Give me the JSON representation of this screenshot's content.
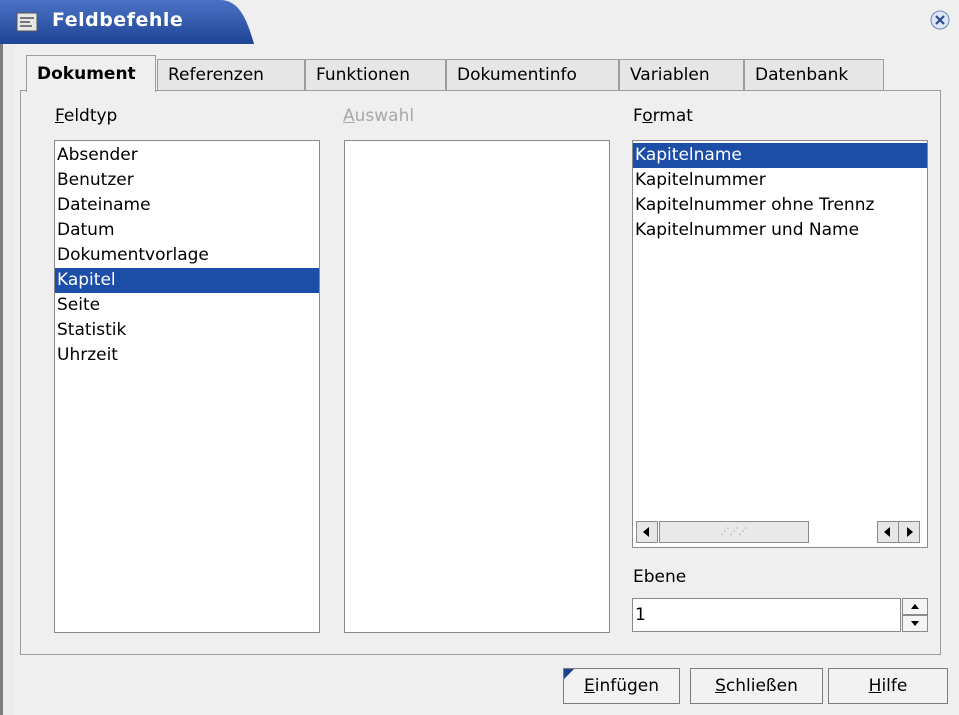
{
  "window": {
    "title": "Feldbefehle"
  },
  "tabs": [
    {
      "label": "Dokument"
    },
    {
      "label": "Referenzen"
    },
    {
      "label": "Funktionen"
    },
    {
      "label": "Dokumentinfo"
    },
    {
      "label": "Variablen"
    },
    {
      "label": "Datenbank"
    }
  ],
  "feldtyp": {
    "label": "Feldtyp",
    "items": [
      "Absender",
      "Benutzer",
      "Dateiname",
      "Datum",
      "Dokumentvorlage",
      "Kapitel",
      "Seite",
      "Statistik",
      "Uhrzeit"
    ],
    "selected": "Kapitel"
  },
  "auswahl": {
    "label": "Auswahl"
  },
  "format": {
    "label": "Format",
    "items": [
      "Kapitelname",
      "Kapitelnummer",
      "Kapitelnummer ohne Trennz",
      "Kapitelnummer und Name"
    ],
    "selected": "Kapitelname"
  },
  "ebene": {
    "label": "Ebene",
    "value": "1"
  },
  "buttons": {
    "insert": "Einfügen",
    "close": "Schließen",
    "help": "Hilfe"
  },
  "colors": {
    "selection": "#1c4ea8",
    "titlebar": "#2b53a6"
  },
  "icons": [
    "window-icon",
    "close-icon",
    "scroll-left-icon",
    "scroll-right-icon",
    "spin-up-icon",
    "spin-down-icon",
    "default-button-marker-icon"
  ]
}
